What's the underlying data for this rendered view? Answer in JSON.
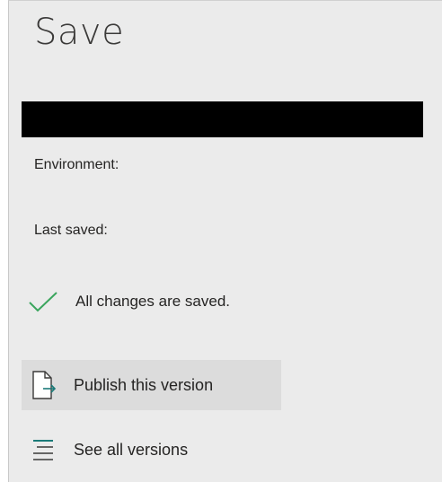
{
  "panel": {
    "title": "Save",
    "environment_label": "Environment:",
    "last_saved_label": "Last saved:",
    "status_text": "All changes are saved.",
    "status_icon": "checkmark-icon",
    "menu": [
      {
        "label": "Publish this version",
        "icon": "publish-document-icon",
        "active": true
      },
      {
        "label": "See all versions",
        "icon": "versions-list-icon",
        "active": false
      }
    ]
  },
  "colors": {
    "panel_bg": "#ebebeb",
    "check_green": "#3aa55d",
    "icon_teal": "#1a7a78",
    "hover_bg": "#dcdcdc"
  }
}
